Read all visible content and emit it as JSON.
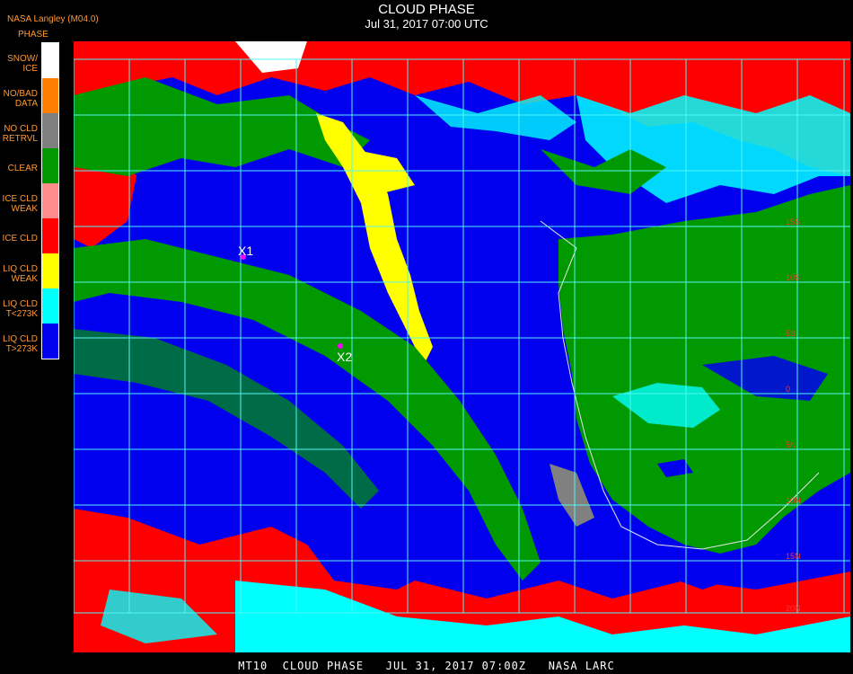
{
  "header": {
    "title": "CLOUD PHASE",
    "date": "Jul 31, 2017 07:00 UTC"
  },
  "source": "NASA Langley (M04.0)",
  "legend": {
    "title": "PHASE",
    "items": [
      {
        "label": "SNOW/\nICE",
        "color": "#ffffff"
      },
      {
        "label": "NO/BAD\nDATA",
        "color": "#ff7f00"
      },
      {
        "label": "NO CLD\nRETRVL",
        "color": "#808080"
      },
      {
        "label": "CLEAR",
        "color": "#009900"
      },
      {
        "label": "ICE CLD\nWEAK",
        "color": "#ff8c8c"
      },
      {
        "label": "ICE CLD",
        "color": "#ff0000"
      },
      {
        "label": "LIQ CLD\nWEAK",
        "color": "#ffff00"
      },
      {
        "label": "LIQ CLD\nT<273K",
        "color": "#00ffff"
      },
      {
        "label": "LIQ CLD\nT>273K",
        "color": "#0000ee"
      }
    ]
  },
  "markers": [
    {
      "label": "X1"
    },
    {
      "label": "X2"
    }
  ],
  "lat_labels": [
    "15S",
    "10S",
    "5S",
    "0",
    "5N",
    "10N",
    "15N",
    "20N"
  ],
  "footer": "MT10  CLOUD PHASE   JUL 31, 2017 07:00Z   NASA LARC"
}
